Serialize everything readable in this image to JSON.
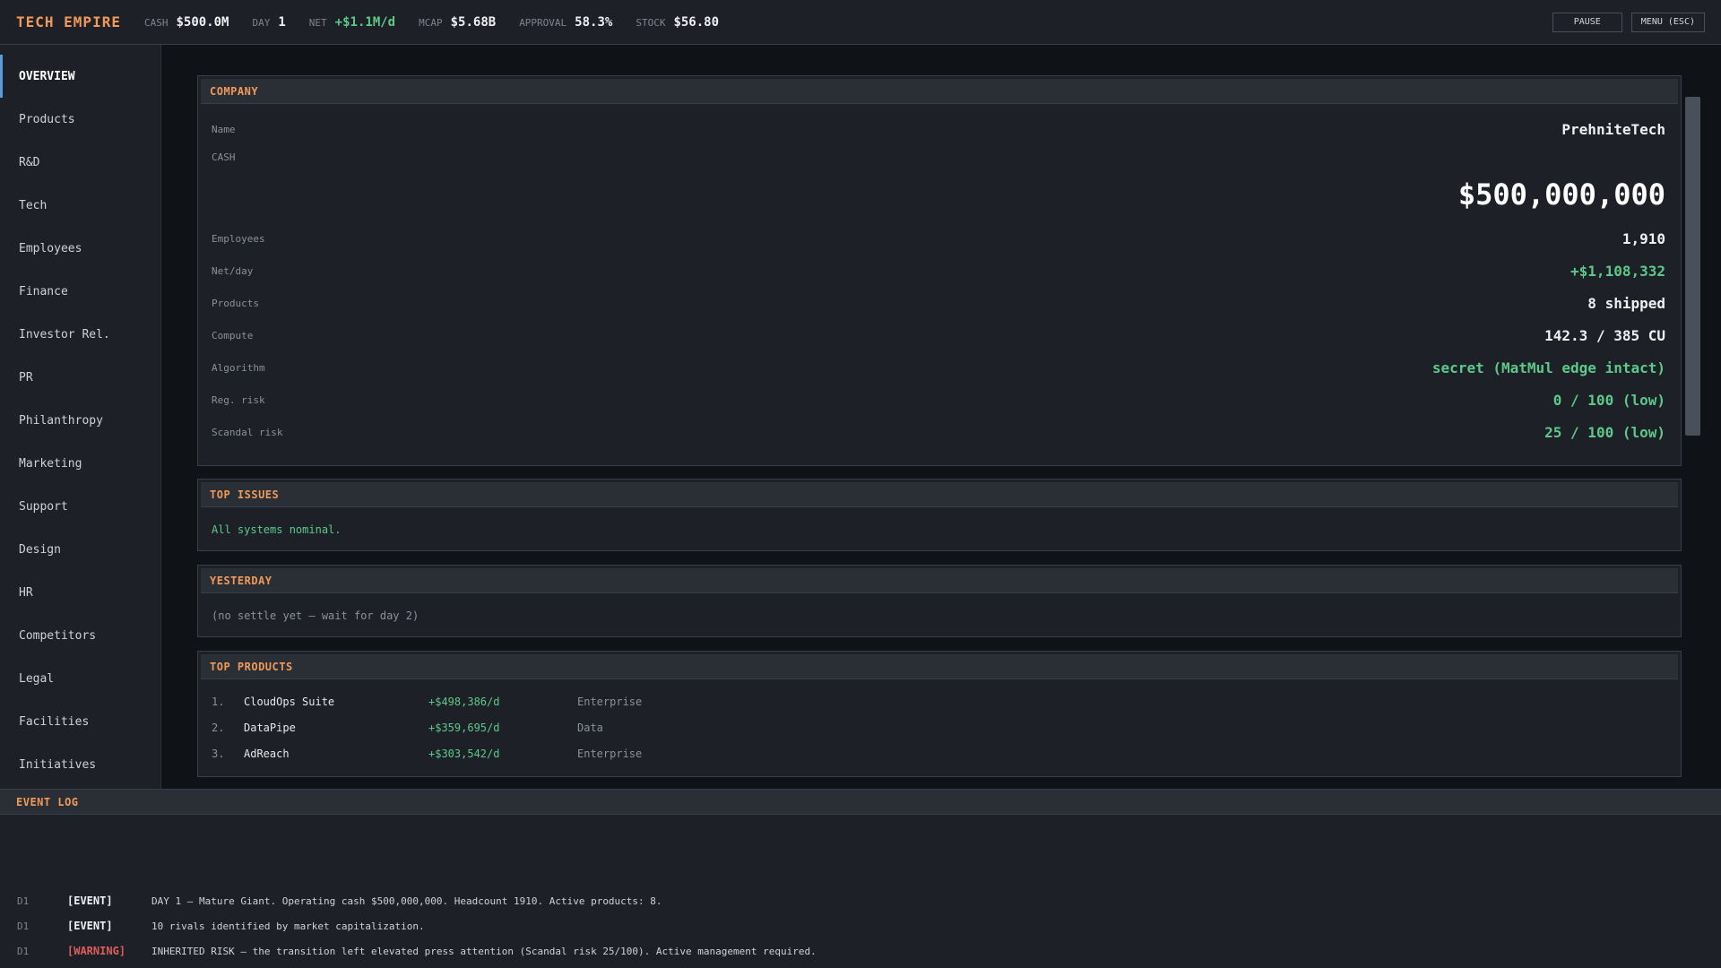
{
  "topbar": {
    "brand": "TECH EMPIRE",
    "stats": [
      {
        "label": "CASH",
        "value": "$500.0M"
      },
      {
        "label": "DAY",
        "value": "1"
      },
      {
        "label": "NET",
        "value": "+$1.1M/d"
      },
      {
        "label": "MCAP",
        "value": "$5.68B"
      },
      {
        "label": "APPROVAL",
        "value": "58.3%"
      },
      {
        "label": "STOCK",
        "value": "$56.80"
      }
    ],
    "pause_label": "PAUSE",
    "menu_label": "MENU (ESC)"
  },
  "sidebar": {
    "items": [
      {
        "label": "OVERVIEW",
        "active": true
      },
      {
        "label": "Products"
      },
      {
        "label": "R&D"
      },
      {
        "label": "Tech"
      },
      {
        "label": "Employees"
      },
      {
        "label": "Finance"
      },
      {
        "label": "Investor Rel."
      },
      {
        "label": "PR"
      },
      {
        "label": "Philanthropy"
      },
      {
        "label": "Marketing"
      },
      {
        "label": "Support"
      },
      {
        "label": "Design"
      },
      {
        "label": "HR"
      },
      {
        "label": "Competitors"
      },
      {
        "label": "Legal"
      },
      {
        "label": "Facilities"
      },
      {
        "label": "Initiatives"
      }
    ]
  },
  "company": {
    "title": "COMPANY",
    "name_label": "Name",
    "name_value": "PrehniteTech",
    "cash_label": "CASH",
    "cash_value": "$500,000,000",
    "rows": [
      {
        "label": "Employees",
        "value": "1,910"
      },
      {
        "label": "Net/day",
        "value": "+$1,108,332"
      },
      {
        "label": "Products",
        "value": "8 shipped"
      },
      {
        "label": "Compute",
        "value": "142.3 / 385 CU"
      },
      {
        "label": "Algorithm",
        "value": "secret (MatMul edge intact)"
      },
      {
        "label": "Reg. risk",
        "value": "0 / 100 (low)"
      },
      {
        "label": "Scandal risk",
        "value": "25 / 100 (low)"
      }
    ]
  },
  "top_issues": {
    "title": "TOP ISSUES",
    "text": "All systems nominal."
  },
  "yesterday": {
    "title": "YESTERDAY",
    "text": "(no settle yet — wait for day 2)"
  },
  "top_products": {
    "title": "TOP PRODUCTS",
    "items": [
      {
        "rank": "1.",
        "name": "CloudOps Suite",
        "revenue": "+$498,386/d",
        "category": "Enterprise"
      },
      {
        "rank": "2.",
        "name": "DataPipe",
        "revenue": "+$359,695/d",
        "category": "Data"
      },
      {
        "rank": "3.",
        "name": "AdReach",
        "revenue": "+$303,542/d",
        "category": "Enterprise"
      }
    ]
  },
  "event_log": {
    "title": "EVENT LOG",
    "entries": [
      {
        "day": "D1",
        "tag": "[EVENT]",
        "message": "DAY 1 — Mature Giant. Operating cash $500,000,000. Headcount 1910. Active products: 8."
      },
      {
        "day": "D1",
        "tag": "[EVENT]",
        "message": "10 rivals identified by market capitalization."
      },
      {
        "day": "D1",
        "tag": "[WARNING]",
        "message": "INHERITED RISK — the transition left elevated press attention (Scandal risk 25/100). Active management required."
      }
    ]
  },
  "colors": {
    "accent": "#f0995a",
    "positive": "#5cc98a",
    "warning": "#e05d5d",
    "nav_active": "#5a9bd8"
  }
}
